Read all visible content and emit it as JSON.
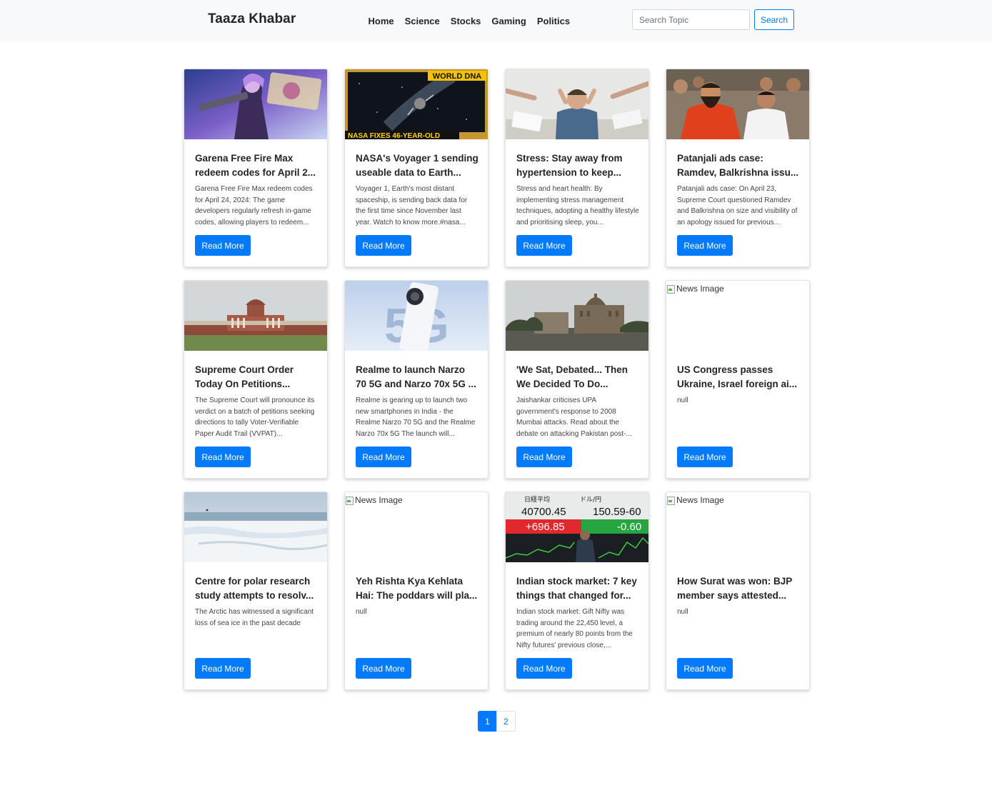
{
  "navbar": {
    "brand": "Taaza Khabar",
    "links": [
      "Home",
      "Science",
      "Stocks",
      "Gaming",
      "Politics"
    ],
    "search_placeholder": "Search Topic",
    "search_value": "",
    "search_button": "Search"
  },
  "cards": [
    {
      "title_line1": "Garena Free Fire Max",
      "title_line2": "redeem codes for April 2...",
      "description": "Garena Free Fire Max redeem codes for April 24, 2024: The game developers regularly refresh in-game codes, allowing players to redeem...",
      "image": "gaming-character",
      "button": "Read More"
    },
    {
      "title_line1": "NASA's Voyager 1 sending",
      "title_line2": "useable data to Earth...",
      "description": "Voyager 1, Earth's most distant spaceship, is sending back data for the first time since November last year. Watch to know more.#nasa...",
      "image": "space-probe",
      "image_banner_top": "WORLD DNA",
      "image_banner_bottom": "NASA FIXES 46-YEAR-OLD",
      "button": "Read More"
    },
    {
      "title_line1": "Stress: Stay away from",
      "title_line2": "hypertension to keep...",
      "description": "Stress and heart health: By implementing stress management techniques, adopting a healthy lifestyle and prioritising sleep, you...",
      "image": "stressed-man",
      "button": "Read More"
    },
    {
      "title_line1": "Patanjali ads case:",
      "title_line2": "Ramdev, Balkrishna issu...",
      "description": "Patanjali ads case: On April 23, Supreme Court questioned Ramdev and Balkrishna on size and visibility of an apology issued for previous...",
      "image": "crowd-photo",
      "button": "Read More"
    },
    {
      "title_line1": "Supreme Court Order",
      "title_line2": "Today On Petitions...",
      "description": "The Supreme Court will pronounce its verdict on a batch of petitions seeking directions to tally Voter-Verifiable Paper Audit Trail (VVPAT)...",
      "image": "court-building",
      "button": "Read More"
    },
    {
      "title_line1": "Realme to launch Narzo",
      "title_line2": "70 5G and Narzo 70x 5G ...",
      "description": "Realme is gearing up to launch two new smartphones in India - the Realme Narzo 70 5G and the Realme Narzo 70x 5G The launch will...",
      "image": "smartphone",
      "image_overlay": "5G",
      "button": "Read More"
    },
    {
      "title_line1": "'We Sat, Debated... Then",
      "title_line2": "We Decided To Do...",
      "description": "Jaishankar criticises UPA government's response to 2008 Mumbai attacks. Read about the debate on attacking Pakistan post-...",
      "image": "hotel-building",
      "button": "Read More"
    },
    {
      "title_line1": "US Congress passes",
      "title_line2": "Ukraine, Israel foreign ai...",
      "description": "null",
      "image": "broken",
      "image_alt": "News Image",
      "button": "Read More"
    },
    {
      "title_line1": "Centre for polar research",
      "title_line2": "study attempts to resolv...",
      "description": "The Arctic has witnessed a significant loss of sea ice in the past decade",
      "image": "arctic-ice",
      "button": "Read More"
    },
    {
      "title_line1": "Yeh Rishta Kya Kehlata",
      "title_line2": "Hai: The poddars will pla...",
      "description": "null",
      "image": "broken",
      "image_alt": "News Image",
      "button": "Read More"
    },
    {
      "title_line1": "Indian stock market: 7 key",
      "title_line2": "things that changed for...",
      "description": "Indian stock market: Gift Nifty was trading around the 22,450 level, a premium of nearly 80 points from the Nifty futures' previous close,...",
      "image": "stock-board",
      "image_labels": {
        "left_title": "日経平均",
        "left_value": "40700.45",
        "left_change": "+696.85",
        "right_title": "ドル/円",
        "right_value": "150.59-60",
        "right_change": "-0.60"
      },
      "button": "Read More"
    },
    {
      "title_line1": "How Surat was won: BJP",
      "title_line2": "member says attested...",
      "description": "null",
      "image": "broken",
      "image_alt": "News Image",
      "button": "Read More"
    }
  ],
  "pagination": {
    "pages": [
      "1",
      "2"
    ],
    "active": "1"
  },
  "colors": {
    "primary": "#007bff",
    "navbar_bg": "#f8f9fa",
    "text": "#212529"
  }
}
